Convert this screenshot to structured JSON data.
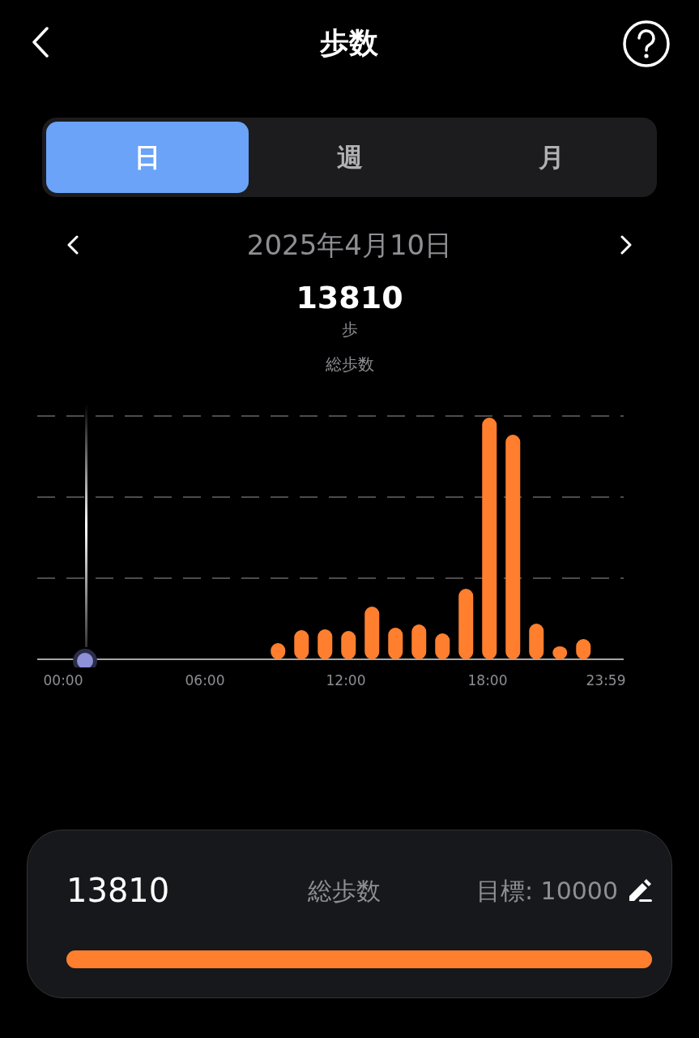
{
  "header": {
    "title": "歩数"
  },
  "tabs": [
    {
      "label": "日",
      "selected": true
    },
    {
      "label": "週",
      "selected": false
    },
    {
      "label": "月",
      "selected": false
    }
  ],
  "date_nav": {
    "date": "2025年4月10日"
  },
  "summary": {
    "total": "13810",
    "unit": "歩",
    "label": "総歩数"
  },
  "chart": {
    "x_labels": [
      "00:00",
      "06:00",
      "12:00",
      "18:00",
      "23:59"
    ]
  },
  "goal_card": {
    "total": "13810",
    "label": "総歩数",
    "goal": "目標: 10000",
    "level": 1
  }
}
